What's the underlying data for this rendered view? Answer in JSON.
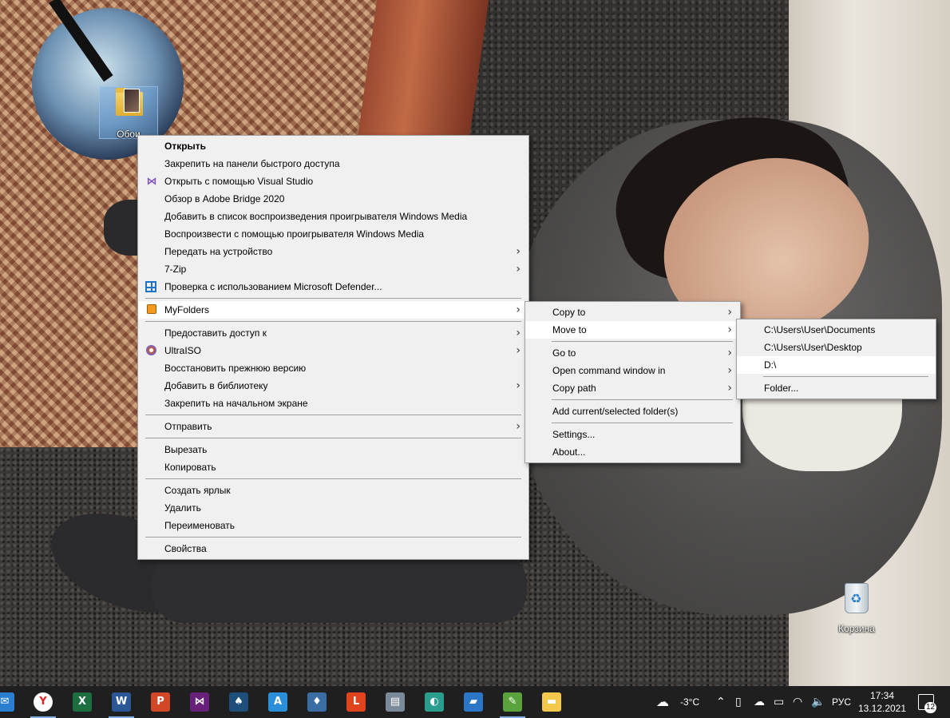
{
  "desktop": {
    "folder_icon": {
      "label": "Обои"
    },
    "recycle_bin": {
      "label": "Корзина"
    }
  },
  "context_menu": {
    "items": [
      {
        "label": "Открыть",
        "bold": true
      },
      {
        "label": "Закрепить на панели быстрого доступа"
      },
      {
        "label": "Открыть с помощью Visual Studio",
        "icon": "visual-studio-icon"
      },
      {
        "label": "Обзор в Adobe Bridge 2020"
      },
      {
        "label": "Добавить в список воспроизведения проигрывателя Windows Media"
      },
      {
        "label": "Воспроизвести с помощью проигрывателя Windows Media"
      },
      {
        "label": "Передать на устройство",
        "submenu": true
      },
      {
        "label": "7-Zip",
        "submenu": true
      },
      {
        "label": "Проверка с использованием Microsoft Defender...",
        "icon": "defender-icon"
      },
      {
        "label": "MyFolders",
        "submenu": true,
        "icon": "myfolders-icon",
        "active": true
      },
      {
        "label": "Предоставить доступ к",
        "submenu": true
      },
      {
        "label": "UltraISO",
        "submenu": true,
        "icon": "ultraiso-icon"
      },
      {
        "label": "Восстановить прежнюю версию"
      },
      {
        "label": "Добавить в библиотеку",
        "submenu": true
      },
      {
        "label": "Закрепить на начальном экране"
      },
      {
        "label": "Отправить",
        "submenu": true
      },
      {
        "label": "Вырезать"
      },
      {
        "label": "Копировать"
      },
      {
        "label": "Создать ярлык"
      },
      {
        "label": "Удалить"
      },
      {
        "label": "Переименовать"
      },
      {
        "label": "Свойства"
      }
    ]
  },
  "myfolders_menu": {
    "items": [
      {
        "label": "Copy to",
        "submenu": true
      },
      {
        "label": "Move to",
        "submenu": true,
        "active": true
      },
      {
        "label": "Go to",
        "submenu": true
      },
      {
        "label": "Open command window in",
        "submenu": true
      },
      {
        "label": "Copy path",
        "submenu": true
      },
      {
        "label": "Add current/selected folder(s)"
      },
      {
        "label": "Settings..."
      },
      {
        "label": "About..."
      }
    ]
  },
  "move_to_menu": {
    "items": [
      {
        "label": "C:\\Users\\User\\Documents"
      },
      {
        "label": "C:\\Users\\User\\Desktop"
      },
      {
        "label": "D:\\",
        "active": true
      },
      {
        "label": "Folder..."
      }
    ]
  },
  "taskbar": {
    "apps": [
      {
        "name": "yandex-browser",
        "glyph": "Y",
        "color": "#ffffff",
        "fg": "#e02424",
        "open": true
      },
      {
        "name": "excel",
        "glyph": "X",
        "color": "#1d6f42"
      },
      {
        "name": "word",
        "glyph": "W",
        "color": "#2b5797",
        "open": true
      },
      {
        "name": "powerpoint",
        "glyph": "P",
        "color": "#d24726"
      },
      {
        "name": "visual-studio",
        "glyph": "⋈",
        "color": "#68217a"
      },
      {
        "name": "solitaire",
        "glyph": "♠",
        "color": "#1e4f7a"
      },
      {
        "name": "app-a",
        "glyph": "A",
        "color": "#2a8fd8"
      },
      {
        "name": "app-notes",
        "glyph": "♦",
        "color": "#3a6ea5"
      },
      {
        "name": "app-l",
        "glyph": "L",
        "color": "#e0441e"
      },
      {
        "name": "app-monitor",
        "glyph": "▤",
        "color": "#7a8a99"
      },
      {
        "name": "edge",
        "glyph": "◐",
        "color": "#2a9d8f"
      },
      {
        "name": "app-cards",
        "glyph": "▰",
        "color": "#2b76c6"
      },
      {
        "name": "app-chart",
        "glyph": "✎",
        "color": "#5aa33c",
        "open": true
      },
      {
        "name": "file-explorer",
        "glyph": "▬",
        "color": "#f2c94c"
      }
    ],
    "weather_temp": "-3°C",
    "language": "РУС",
    "time": "17:34",
    "date": "13.12.2021",
    "notification_count": "12"
  }
}
